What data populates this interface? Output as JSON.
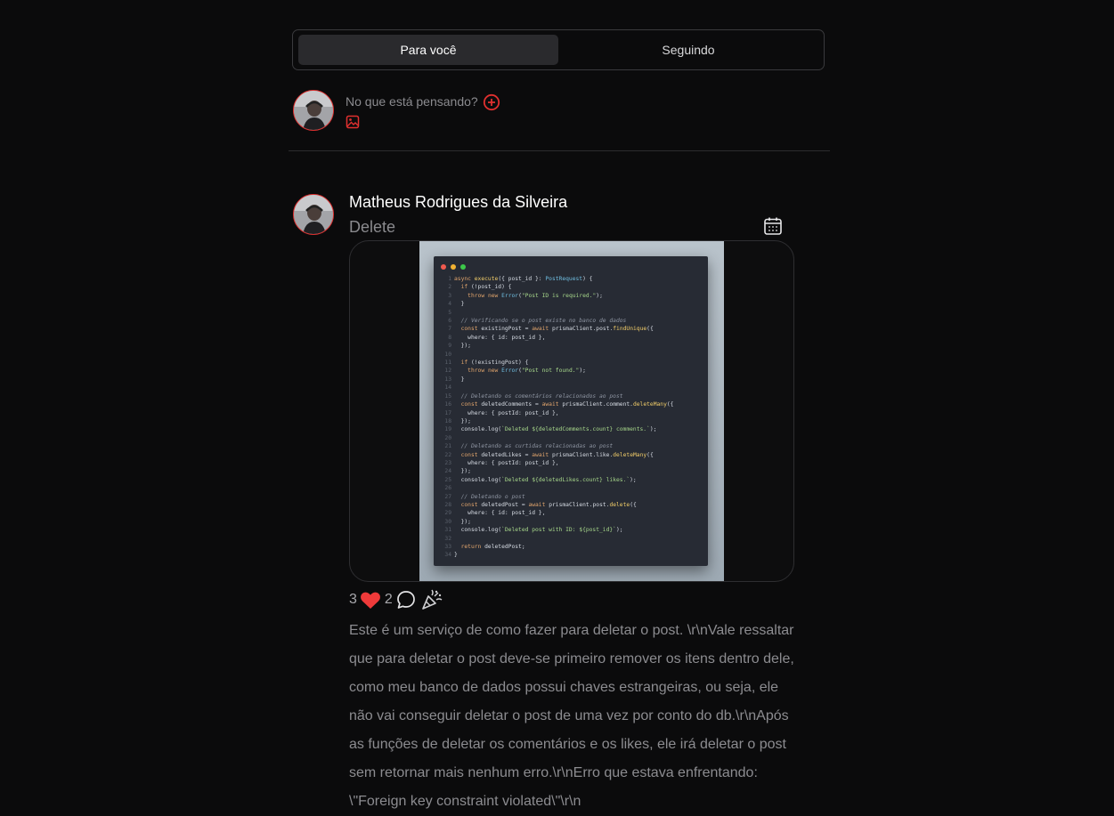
{
  "tabs": [
    {
      "label": "Para você",
      "active": true
    },
    {
      "label": "Seguindo",
      "active": false
    }
  ],
  "composer": {
    "placeholder": "No que está pensando?",
    "add_icon": "plus-circle-icon",
    "image_icon": "image-icon"
  },
  "post": {
    "author": "Matheus Rodrigues da Silveira",
    "title": "Delete",
    "date_icon": "calendar-icon",
    "likes_count": "3",
    "comments_count": "2",
    "like_icon": "heart-icon",
    "comment_icon": "comment-bubble-icon",
    "celebrate_icon": "party-popper-icon",
    "description_lines": [
      "Este é um serviço de como fazer para deletar o post. \\r\\nVale ressaltar",
      "que para deletar o post deve-se primeiro remover os itens dentro dele,",
      "como meu banco de dados possui chaves estrangeiras, ou seja, ele",
      "não vai conseguir deletar o post de uma vez por conto do db.\\r\\nApós",
      "as funções de deletar os comentários e os likes, ele irá deletar o post",
      "sem retornar mais nenhum erro.\\r\\nErro que estava enfrentando:",
      "\\\"Foreign key constraint violated\\\"\\r\\n"
    ],
    "code_lines": [
      "async execute({ post_id }: PostRequest) {",
      "  if (!post_id) {",
      "    throw new Error(\"Post ID is required.\");",
      "  }",
      "",
      "  // Verificando se o post existe no banco de dados",
      "  const existingPost = await prismaClient.post.findUnique({",
      "    where: { id: post_id },",
      "  });",
      "",
      "  if (!existingPost) {",
      "    throw new Error(\"Post not found.\");",
      "  }",
      "",
      "  // Deletando os comentários relacionados ao post",
      "  const deletedComments = await prismaClient.comment.deleteMany({",
      "    where: { postId: post_id },",
      "  });",
      "  console.log(`Deleted ${deletedComments.count} comments.`);",
      "",
      "  // Deletando as curtidas relacionadas ao post",
      "  const deletedLikes = await prismaClient.like.deleteMany({",
      "    where: { postId: post_id },",
      "  });",
      "  console.log(`Deleted ${deletedLikes.count} likes.`);",
      "",
      "  // Deletando o post",
      "  const deletedPost = await prismaClient.post.delete({",
      "    where: { id: post_id },",
      "  });",
      "  console.log(`Deleted post with ID: ${post_id}`);",
      "",
      "  return deletedPost;",
      "}"
    ]
  },
  "colors": {
    "accent": "#e0302f",
    "background": "#0b0b0c"
  }
}
